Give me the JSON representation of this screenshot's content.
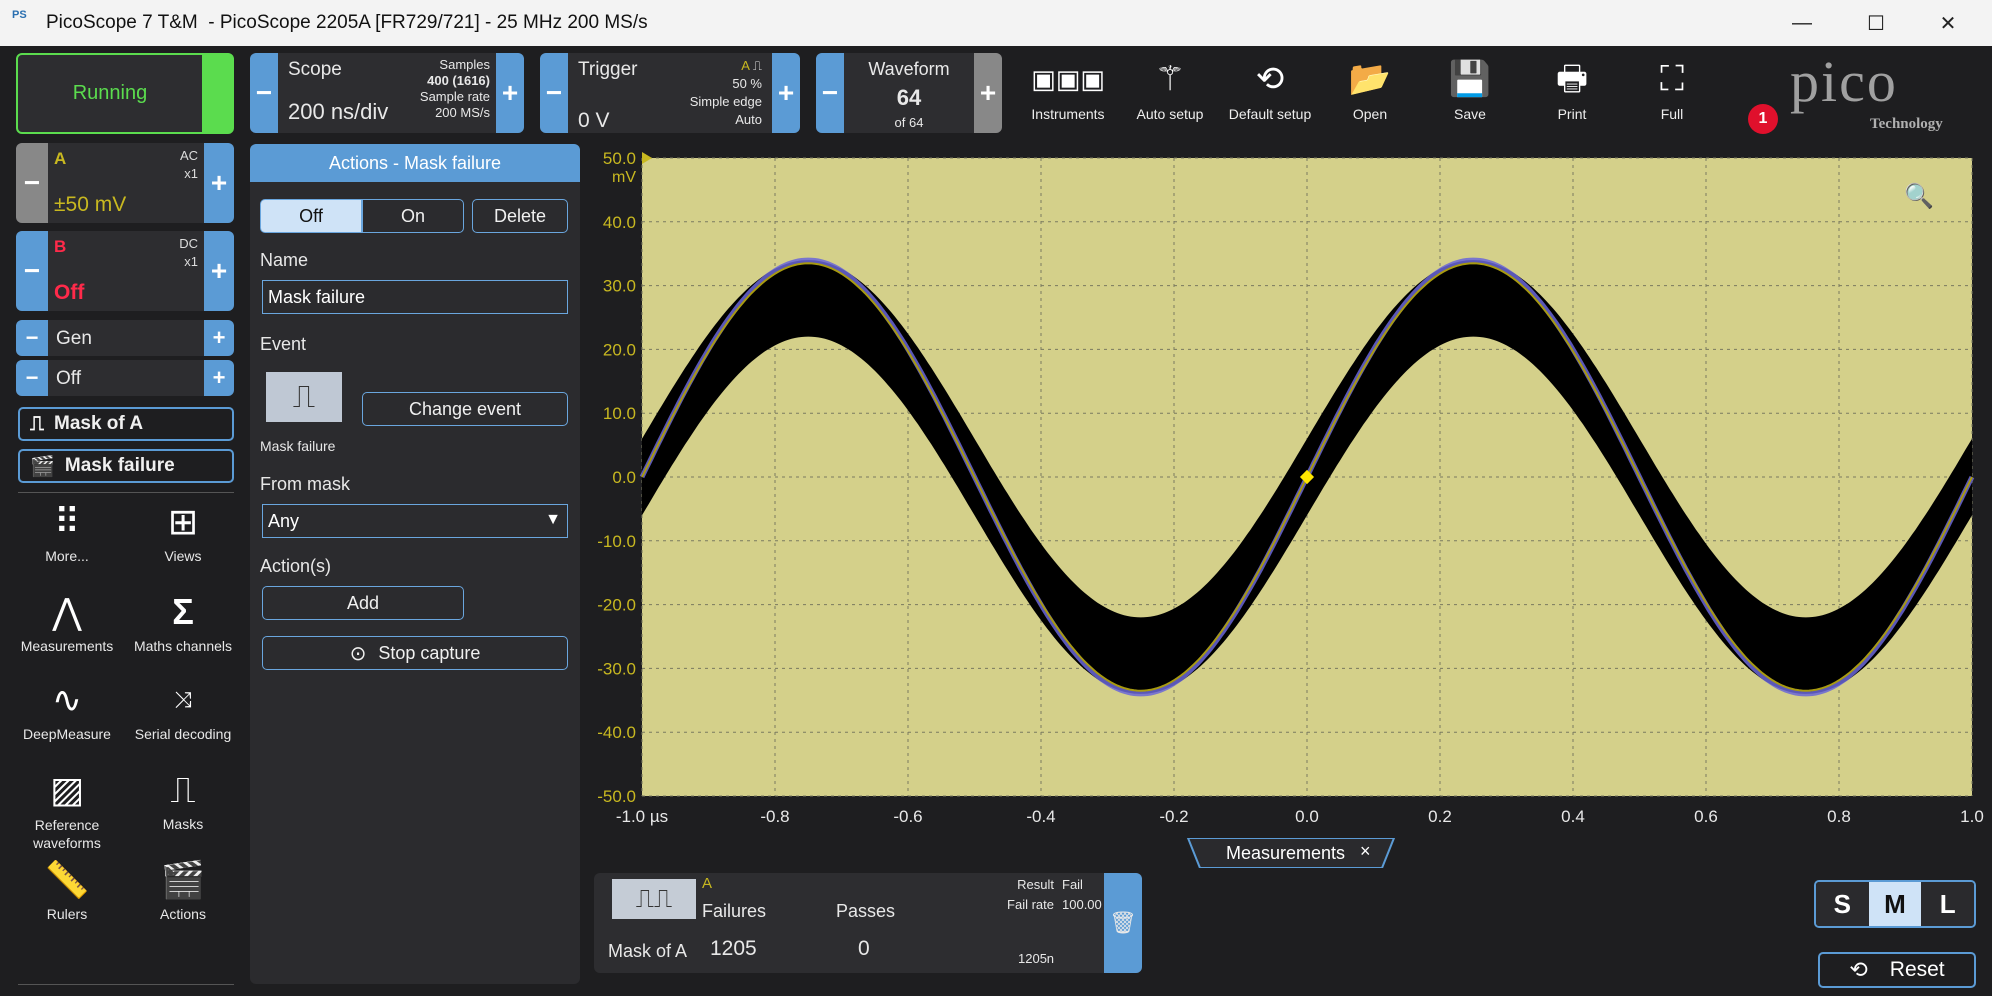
{
  "window": {
    "logo": "PS",
    "title": "PicoScope 7 T&M  - PicoScope 2205A [FR729/721] - 25 MHz 200 MS/s",
    "minimize": "—",
    "maximize": "☐",
    "close": "✕"
  },
  "status": {
    "running": "Running"
  },
  "channels": [
    {
      "letter": "A",
      "coupling": "AC",
      "probe": "x1",
      "range": "±50 mV",
      "color": "#c8b820"
    },
    {
      "letter": "B",
      "coupling": "DC",
      "probe": "x1",
      "range": "Off",
      "color": "#ff2a4a"
    }
  ],
  "gen": {
    "label": "Gen",
    "state": "Off"
  },
  "pills": {
    "mask": "Mask of A",
    "action": "Mask failure"
  },
  "tools": [
    {
      "label": "More...",
      "icon": "dots-grid-icon"
    },
    {
      "label": "Views",
      "icon": "grid-icon"
    },
    {
      "label": "Measurements",
      "icon": "caliper-icon"
    },
    {
      "label": "Maths channels",
      "icon": "sigma-icon"
    },
    {
      "label": "DeepMeasure",
      "icon": "deepmeasure-icon"
    },
    {
      "label": "Serial decoding",
      "icon": "serial-icon"
    },
    {
      "label": "Reference waveforms",
      "icon": "reference-icon"
    },
    {
      "label": "Masks",
      "icon": "mask-icon"
    },
    {
      "label": "Rulers",
      "icon": "ruler-icon"
    },
    {
      "label": "Actions",
      "icon": "clapper-icon"
    }
  ],
  "scope": {
    "title": "Scope",
    "timebase": "200 ns/div",
    "samples_label": "Samples",
    "samples": "400 (1616)",
    "rate_label": "Sample rate",
    "rate": "200 MS/s"
  },
  "trigger": {
    "title": "Trigger",
    "level": "0 V",
    "channel": "A",
    "percent": "50 %",
    "type": "Simple edge",
    "mode": "Auto"
  },
  "waveform": {
    "title": "Waveform",
    "current": "64",
    "of": "of 64"
  },
  "toolbar": {
    "instruments": "Instruments",
    "auto_setup": "Auto setup",
    "default_setup": "Default setup",
    "open": "Open",
    "save": "Save",
    "print": "Print",
    "full": "Full"
  },
  "brand": {
    "name": "pico",
    "sub": "Technology",
    "badge": "1"
  },
  "actions_panel": {
    "title": "Actions - Mask failure",
    "off": "Off",
    "on": "On",
    "delete": "Delete",
    "name_label": "Name",
    "name_value": "Mask failure",
    "event_label": "Event",
    "event_name": "Mask failure",
    "change_event": "Change event",
    "from_mask_label": "From mask",
    "from_mask_value": "Any",
    "actions_label": "Action(s)",
    "add": "Add",
    "stop_capture": "Stop capture"
  },
  "plot": {
    "y_unit": "mV",
    "y_ticks": [
      "50.0",
      "40.0",
      "30.0",
      "20.0",
      "10.0",
      "0.0",
      "-10.0",
      "-20.0",
      "-30.0",
      "-40.0",
      "-50.0"
    ],
    "x_ticks": [
      "-1.0 µs",
      "-0.8",
      "-0.6",
      "-0.4",
      "-0.2",
      "0.0",
      "0.2",
      "0.4",
      "0.6",
      "0.8",
      "1.0"
    ],
    "bg_color": "#d4d08a",
    "trace_color": "#a89a10",
    "overlay_color": "#6a66d8",
    "mask_color": "#000000"
  },
  "measurements_tab": {
    "label": "Measurements",
    "close": "×"
  },
  "measurement": {
    "channel": "A",
    "failures_label": "Failures",
    "passes_label": "Passes",
    "mask": "Mask of A",
    "failures": "1205",
    "passes": "0",
    "result_label": "Result",
    "result": "Fail",
    "fail_rate_label": "Fail rate",
    "fail_rate": "100.00 %",
    "n_label": "n",
    "n": "1205"
  },
  "sizes": {
    "s": "S",
    "m": "M",
    "l": "L"
  },
  "reset": "Reset"
}
